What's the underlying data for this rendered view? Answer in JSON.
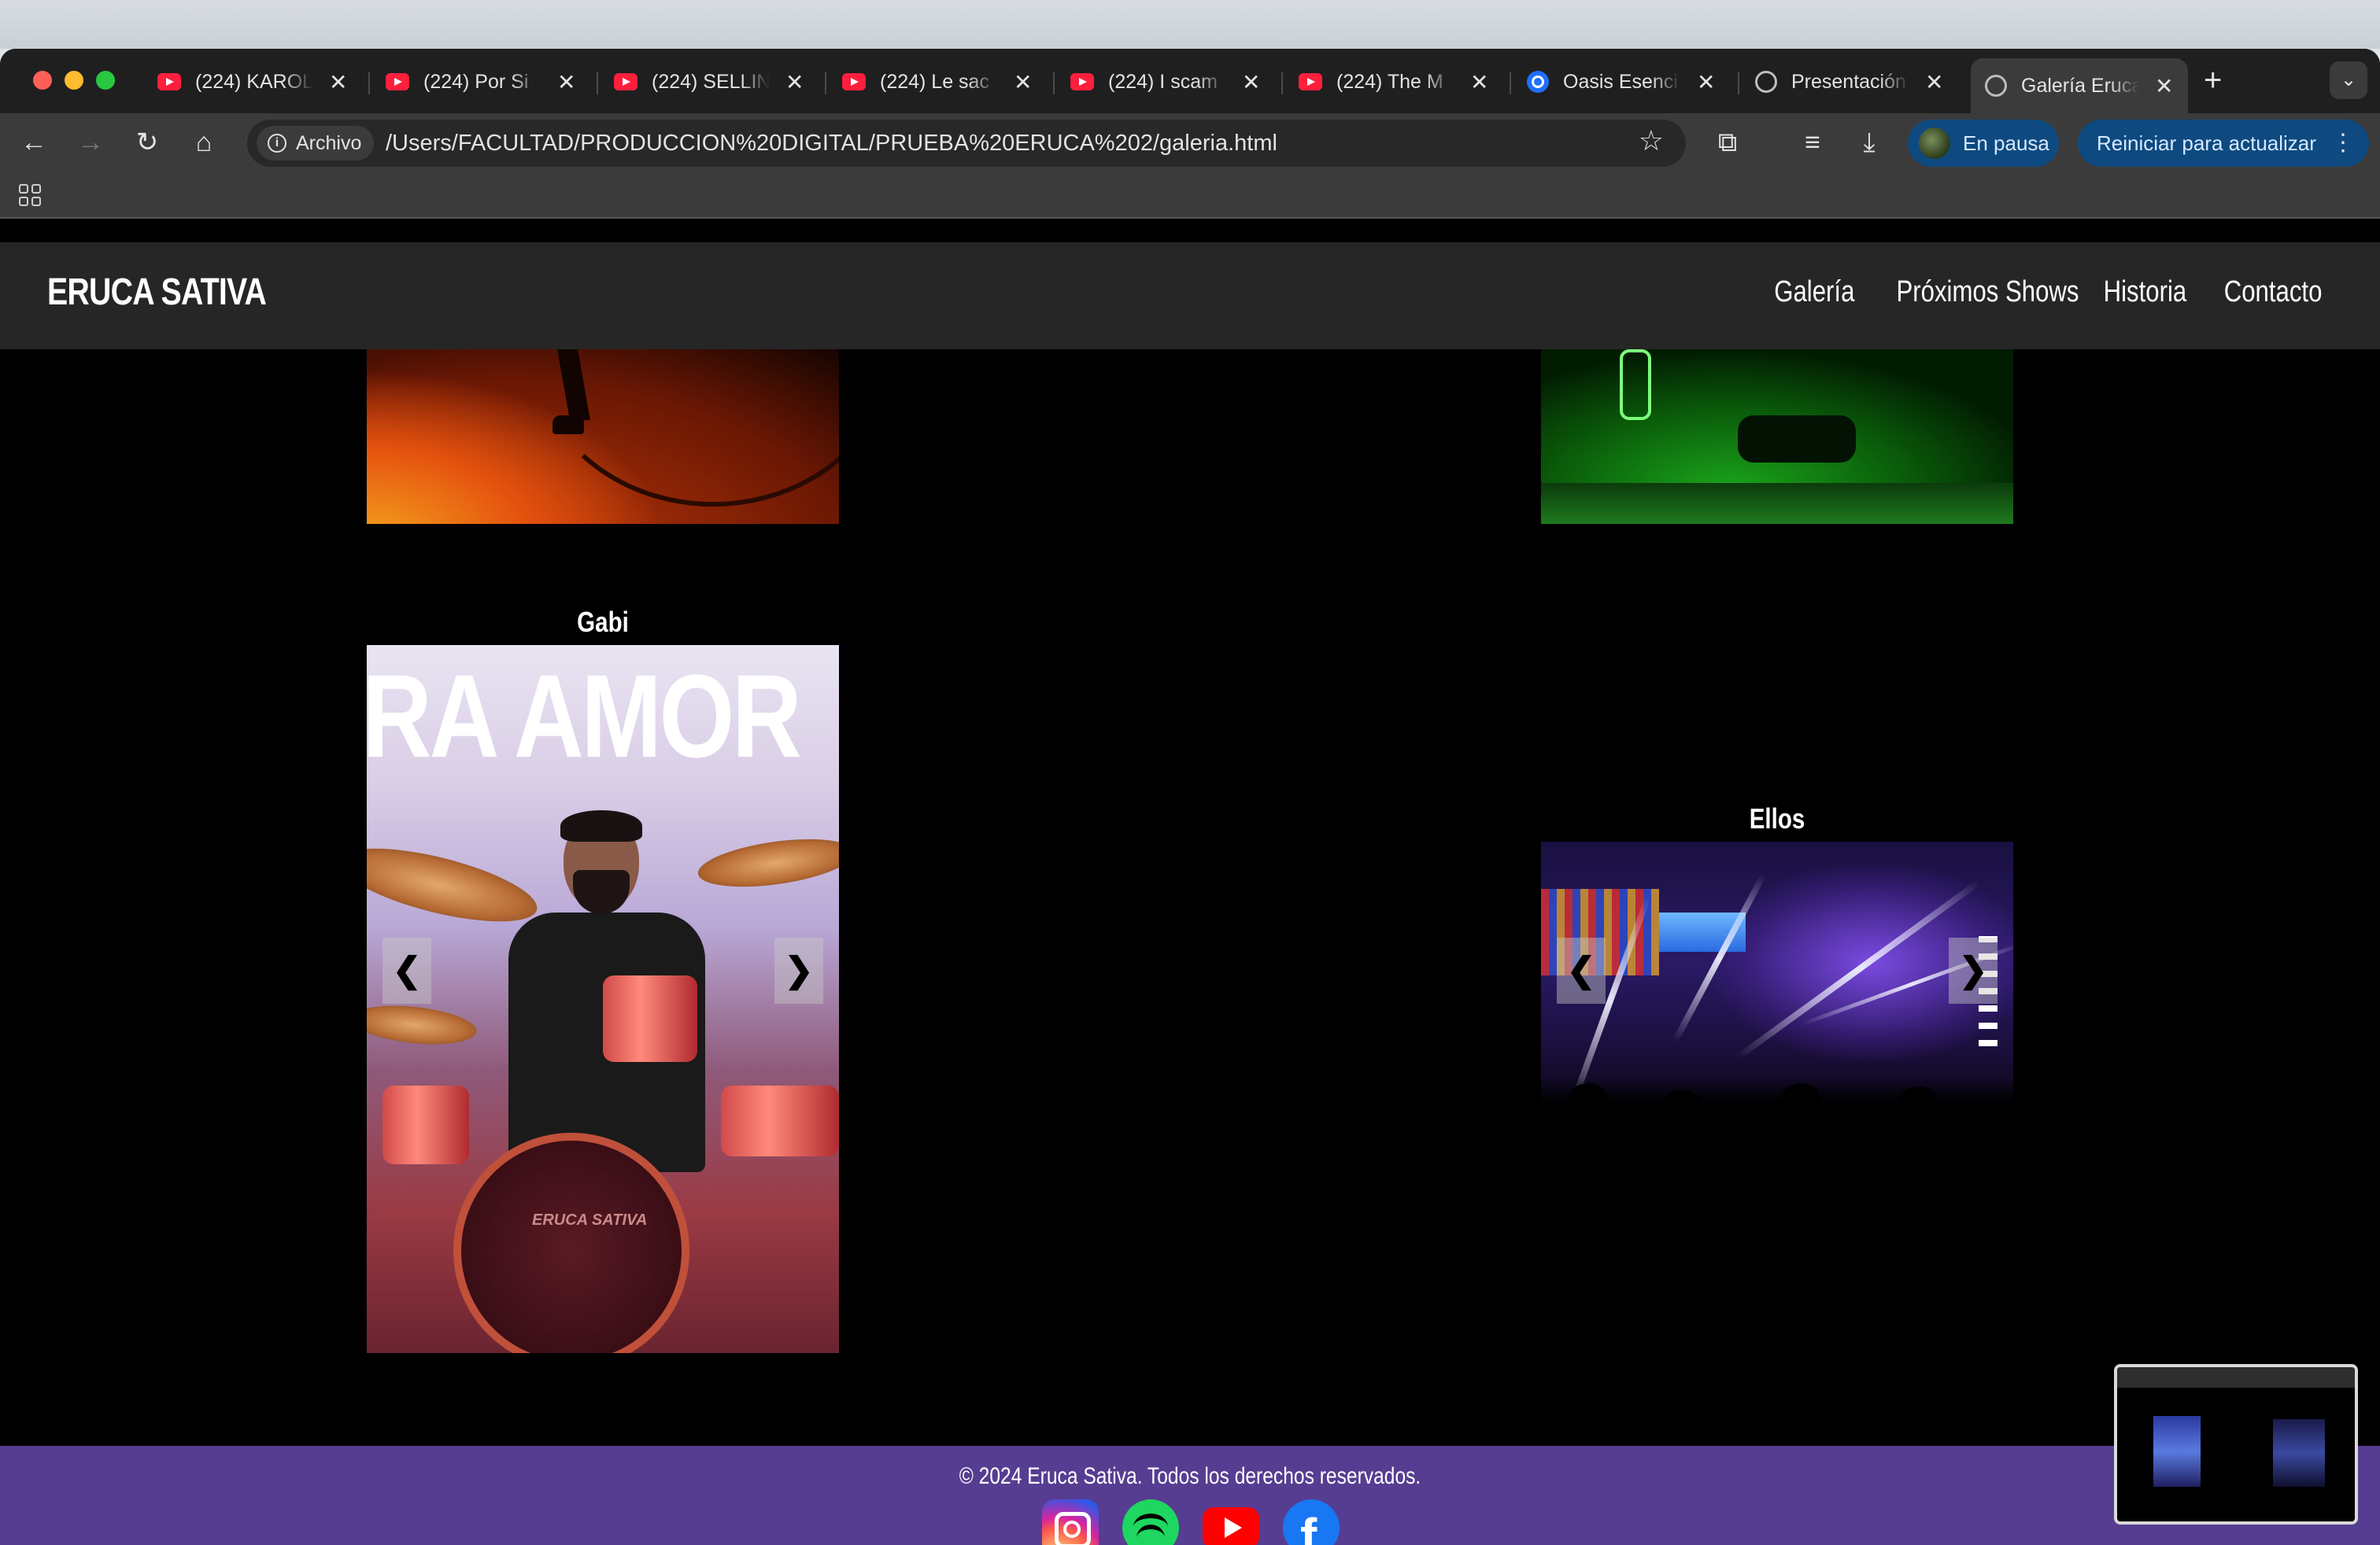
{
  "browser": {
    "tabs": [
      {
        "label": "(224) KAROL",
        "icon": "youtube-icon"
      },
      {
        "label": "(224) Por Si",
        "icon": "youtube-icon"
      },
      {
        "label": "(224) SELLIN",
        "icon": "youtube-icon"
      },
      {
        "label": "(224) Le sac",
        "icon": "youtube-icon"
      },
      {
        "label": "(224) I scam",
        "icon": "youtube-icon"
      },
      {
        "label": "(224) The M",
        "icon": "youtube-icon"
      },
      {
        "label": "Oasis Esenci",
        "icon": "oasis-icon"
      },
      {
        "label": "Presentación",
        "icon": "globe-icon"
      },
      {
        "label": "Galería Eruca",
        "icon": "globe-icon",
        "active": true
      }
    ],
    "address": {
      "chip_label": "Archivo",
      "url": "/Users/FACULTAD/PRODUCCION%20DIGITAL/PRUEBA%20ERUCA%202/galeria.html"
    },
    "profile_status": "En pausa",
    "update_label": "Reiniciar para actualizar"
  },
  "site": {
    "logo": "ERUCA SATIVA",
    "nav": [
      "Galería",
      "Próximos Shows",
      "Historia",
      "Contacto"
    ],
    "galleries": {
      "gabi": {
        "title": "Gabi",
        "banner_text": "RA AMOR",
        "kick_text": "ERUCA SATIVA"
      },
      "ellos": {
        "title": "Ellos"
      }
    },
    "arrows": {
      "prev": "❮",
      "next": "❯"
    },
    "footer": {
      "copyright": "© 2024 Eruca Sativa. Todos los derechos reservados.",
      "socials": [
        "instagram-icon",
        "spotify-icon",
        "youtube-icon",
        "facebook-icon"
      ]
    }
  },
  "colors": {
    "header_bg": "#262626",
    "footer_bg": "#563d91",
    "page_bg": "#000000"
  }
}
